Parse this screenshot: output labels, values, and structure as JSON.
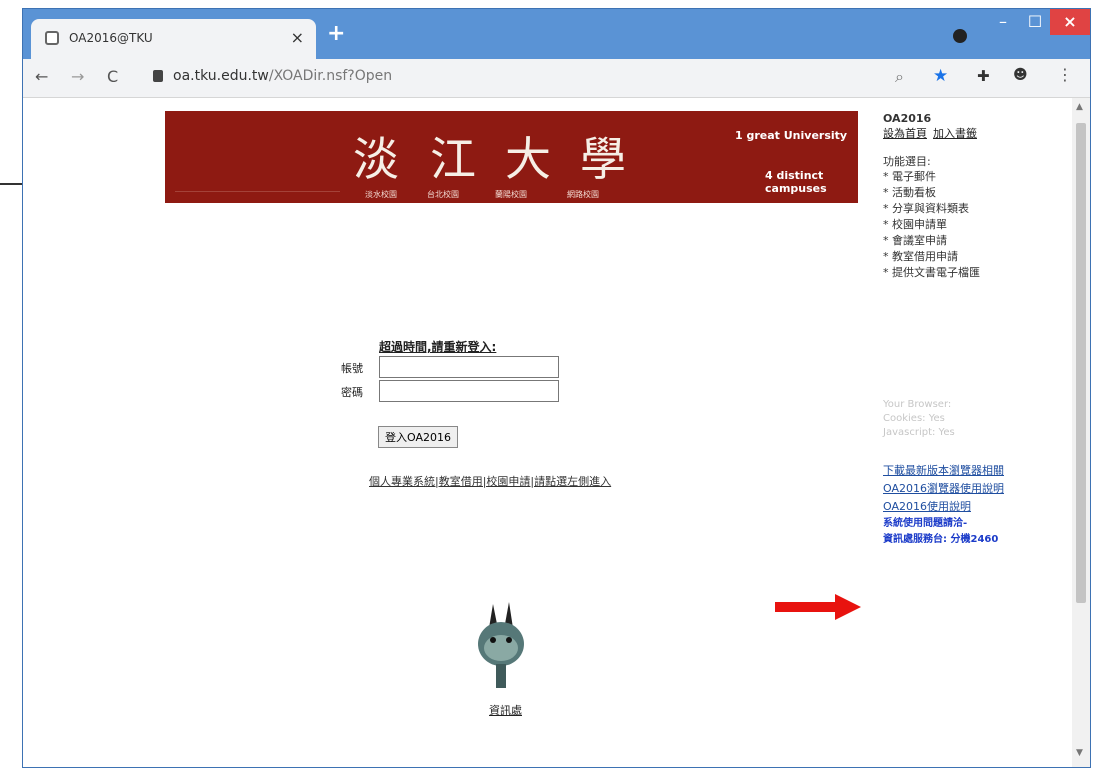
{
  "browser": {
    "tab_title": "OA2016@TKU",
    "tab_close": "×",
    "new_tab": "+",
    "minimize": "–",
    "maximize": "☐",
    "close": "×",
    "url_domain": "oa.tku.edu.tw",
    "url_path": "/XOADir.nsf?Open"
  },
  "banner": {
    "title_chars": [
      "淡",
      "江",
      "大",
      "學"
    ],
    "campuses": [
      "淡水校園",
      "台北校園",
      "蘭陽校園",
      "網路校園"
    ],
    "tagline_top": "1 great University",
    "tagline_bottom": "4 distinct campuses"
  },
  "sidebar": {
    "system_name": "OA2016",
    "set_home": "設為首頁",
    "add_favorite": "加入書籤",
    "section_title": "功能選目:",
    "items": [
      "* 電子郵件",
      "* 活動看板",
      "* 分享與資料類表",
      "* 校園申請單",
      "* 會議室申請",
      "* 教室借用申請",
      "* 提供文書電子檔匯"
    ]
  },
  "browser_info": {
    "browser": "Your Browser:",
    "cookies": "Cookies: Yes",
    "javascript": "Javascript: Yes"
  },
  "links": {
    "download": "下載最新版本瀏覽器相關",
    "guide": "OA2016瀏覽器使用說明",
    "usage": "OA2016使用說明",
    "contact1": "系統使用問題請洽-",
    "contact2": "資訊處服務台: 分機2460"
  },
  "login": {
    "title": "超過時間,請重新登入:",
    "account_label": "帳號",
    "password_label": "密碼",
    "account_value": "",
    "password_value": "",
    "button": "登入OA2016",
    "links": "個人專業系統|教室借用|校園申請|請點選左側進入"
  },
  "mascot": {
    "label": "資訊處"
  },
  "colors": {
    "banner": "#8e1a12",
    "arrow": "#e8130f",
    "window_frame": "#5a93d5"
  }
}
